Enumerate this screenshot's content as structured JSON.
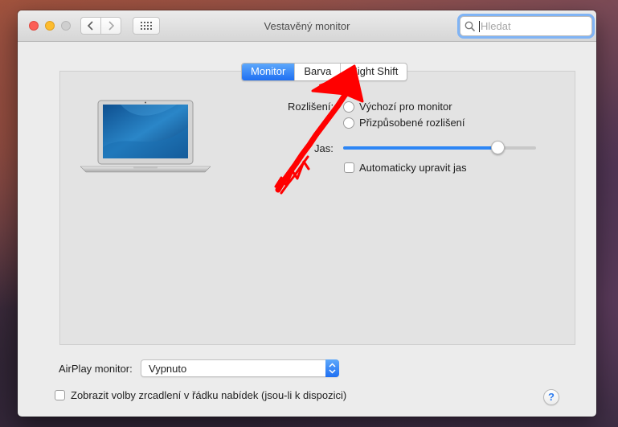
{
  "window": {
    "title": "Vestavěný monitor",
    "search_placeholder": "Hledat"
  },
  "toolbar": {
    "back_icon": "chevron-left-icon",
    "forward_icon": "chevron-right-icon",
    "grid_icon": "grid-icon"
  },
  "tabs": [
    {
      "label": "Monitor",
      "active": true
    },
    {
      "label": "Barva",
      "active": false
    },
    {
      "label": "Night Shift",
      "active": false
    }
  ],
  "monitor": {
    "resolution_label": "Rozlišení:",
    "resolution_options": [
      {
        "label": "Výchozí pro monitor",
        "selected": true
      },
      {
        "label": "Přizpůsobené rozlišení",
        "selected": false
      }
    ],
    "brightness_label": "Jas:",
    "brightness_level": 0.8,
    "auto_brightness_label": "Automaticky upravit jas",
    "auto_brightness_checked": false
  },
  "airplay": {
    "label": "AirPlay monitor:",
    "value": "Vypnuto"
  },
  "mirroring": {
    "label": "Zobrazit volby zrcadlení v řádku nabídek (jsou-li k dispozici)",
    "checked": false
  },
  "help": {
    "label": "?"
  },
  "colors": {
    "accent": "#2d86f5",
    "annotation": "#ff0000"
  }
}
